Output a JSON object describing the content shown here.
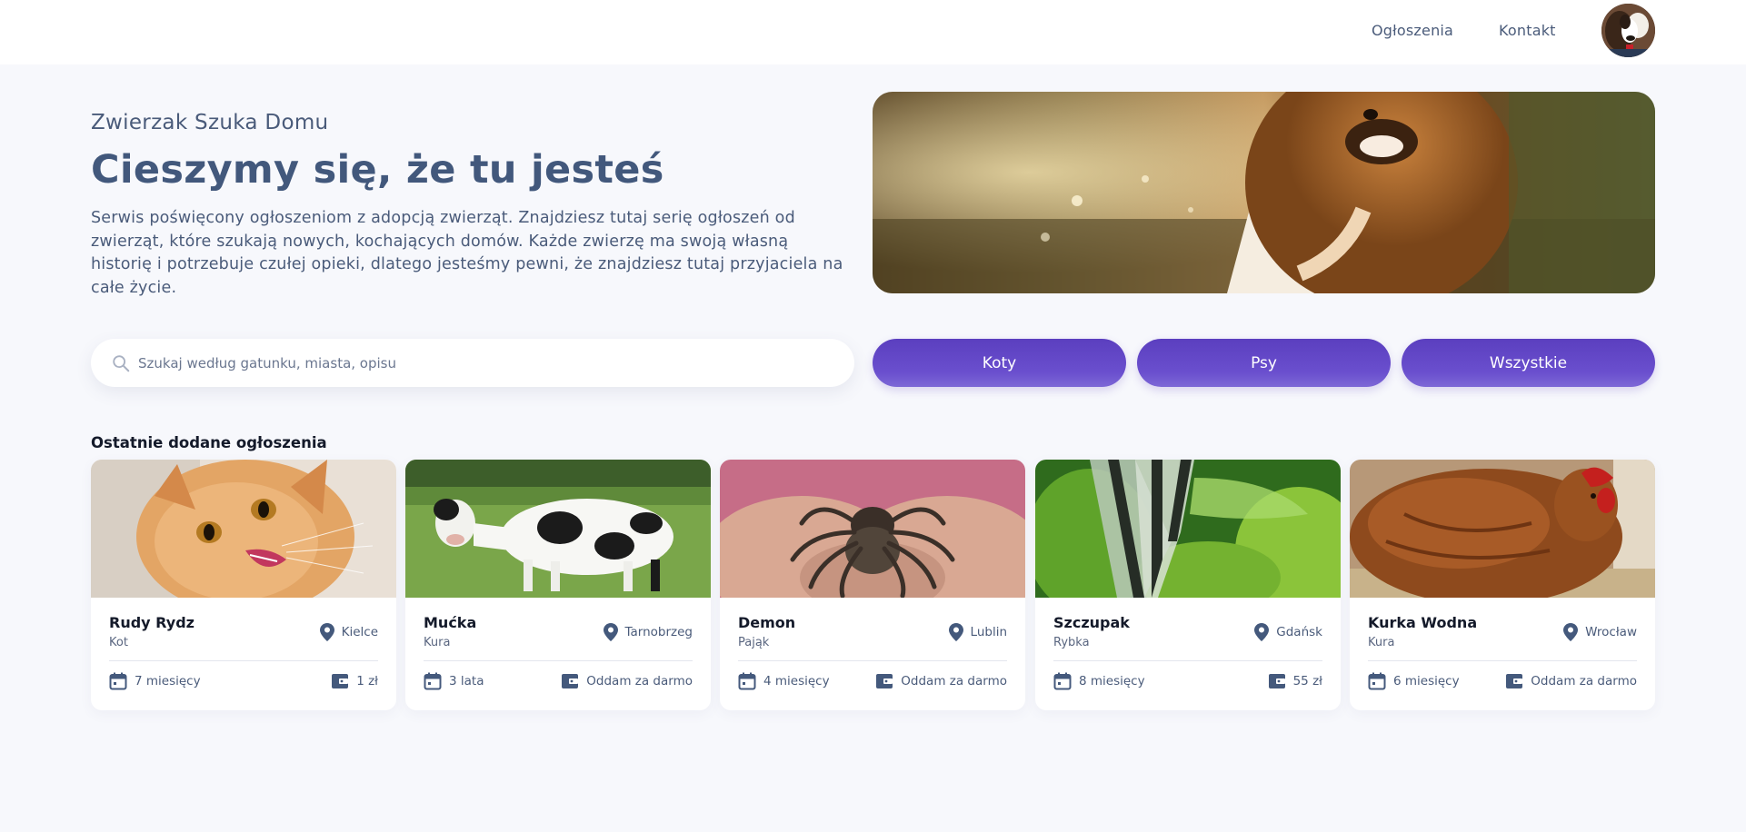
{
  "nav": {
    "links": [
      "Ogłoszenia",
      "Kontakt"
    ]
  },
  "hero": {
    "brand": "Zwierzak Szuka Domu",
    "headline": "Cieszymy się, że tu jesteś",
    "intro": "Serwis poświęcony ogłoszeniom z adopcją zwierząt. Znajdziesz tutaj serię ogłoszeń od zwierząt, które szukają nowych, kochających domów. Każde zwierzę ma swoją własną historię i potrzebuje czułej opieki, dlatego jesteśmy pewni, że znajdziesz tutaj przyjaciela na całe życie."
  },
  "search": {
    "placeholder": "Szukaj według gatunku, miasta, opisu",
    "value": ""
  },
  "filters": [
    "Koty",
    "Psy",
    "Wszystkie"
  ],
  "listings": {
    "title": "Ostatnie dodane ogłoszenia",
    "cards": [
      {
        "name": "Rudy Rydz",
        "species": "Kot",
        "city": "Kielce",
        "age": "7 miesięcy",
        "price": "1 zł"
      },
      {
        "name": "Mućka",
        "species": "Kura",
        "city": "Tarnobrzeg",
        "age": "3 lata",
        "price": "Oddam za darmo"
      },
      {
        "name": "Demon",
        "species": "Pająk",
        "city": "Lublin",
        "age": "4 miesięcy",
        "price": "Oddam za darmo"
      },
      {
        "name": "Szczupak",
        "species": "Rybka",
        "city": "Gdańsk",
        "age": "8 miesięcy",
        "price": "55 zł"
      },
      {
        "name": "Kurka Wodna",
        "species": "Kura",
        "city": "Wrocław",
        "age": "6 miesięcy",
        "price": "Oddam za darmo"
      }
    ]
  },
  "colors": {
    "accent": "#5b3fbf",
    "text": "#4a5b7a",
    "heading": "#42587c",
    "background": "#f7f8fc"
  },
  "icons": {
    "search": "search-icon",
    "location": "location-pin-icon",
    "age": "calendar-icon",
    "price": "wallet-icon"
  }
}
